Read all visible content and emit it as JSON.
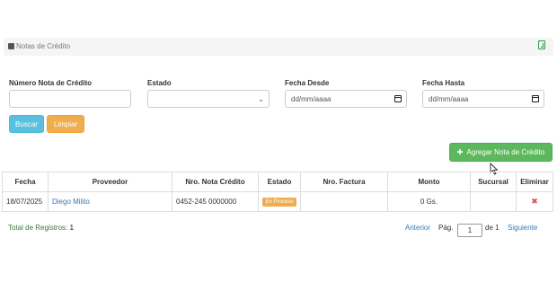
{
  "panel": {
    "title": "Notas de Crédito",
    "export_icon": "excel-file-icon"
  },
  "filters": {
    "numero_label": "Número Nota de Crédito",
    "numero_value": "",
    "estado_label": "Estado",
    "estado_selected": "",
    "fecha_desde_label": "Fecha Desde",
    "fecha_desde_value": "dd/mm/aaaa",
    "fecha_hasta_label": "Fecha Hasta",
    "fecha_hasta_value": "dd/mm/aaaa"
  },
  "buttons": {
    "buscar": "Buscar",
    "limpiar": "Limpiar",
    "agregar": "Agregar Nota de Crédito"
  },
  "table": {
    "headers": [
      "Fecha",
      "Proveedor",
      "Nro. Nota Crédito",
      "Estado",
      "Nro. Factura",
      "Monto",
      "Sucursal",
      "Eliminar"
    ],
    "rows": [
      {
        "fecha": "18/07/2025",
        "proveedor": "Diego Milito",
        "nro_nota": "0452-245 0000000",
        "estado": "En Proceso",
        "nro_factura": "",
        "monto": "0 Gs.",
        "sucursal": ""
      }
    ]
  },
  "footer": {
    "total_label": "Total de Registros:",
    "total_count": "1"
  },
  "pager": {
    "anterior": "Anterior",
    "pag_label": "Pág.",
    "page": "1",
    "of_label": "de 1",
    "siguiente": "Siguiente"
  },
  "colors": {
    "info": "#5bc0de",
    "warning": "#f0ad4e",
    "success": "#5cb85c",
    "danger": "#d9534f",
    "link": "#337ab7"
  }
}
